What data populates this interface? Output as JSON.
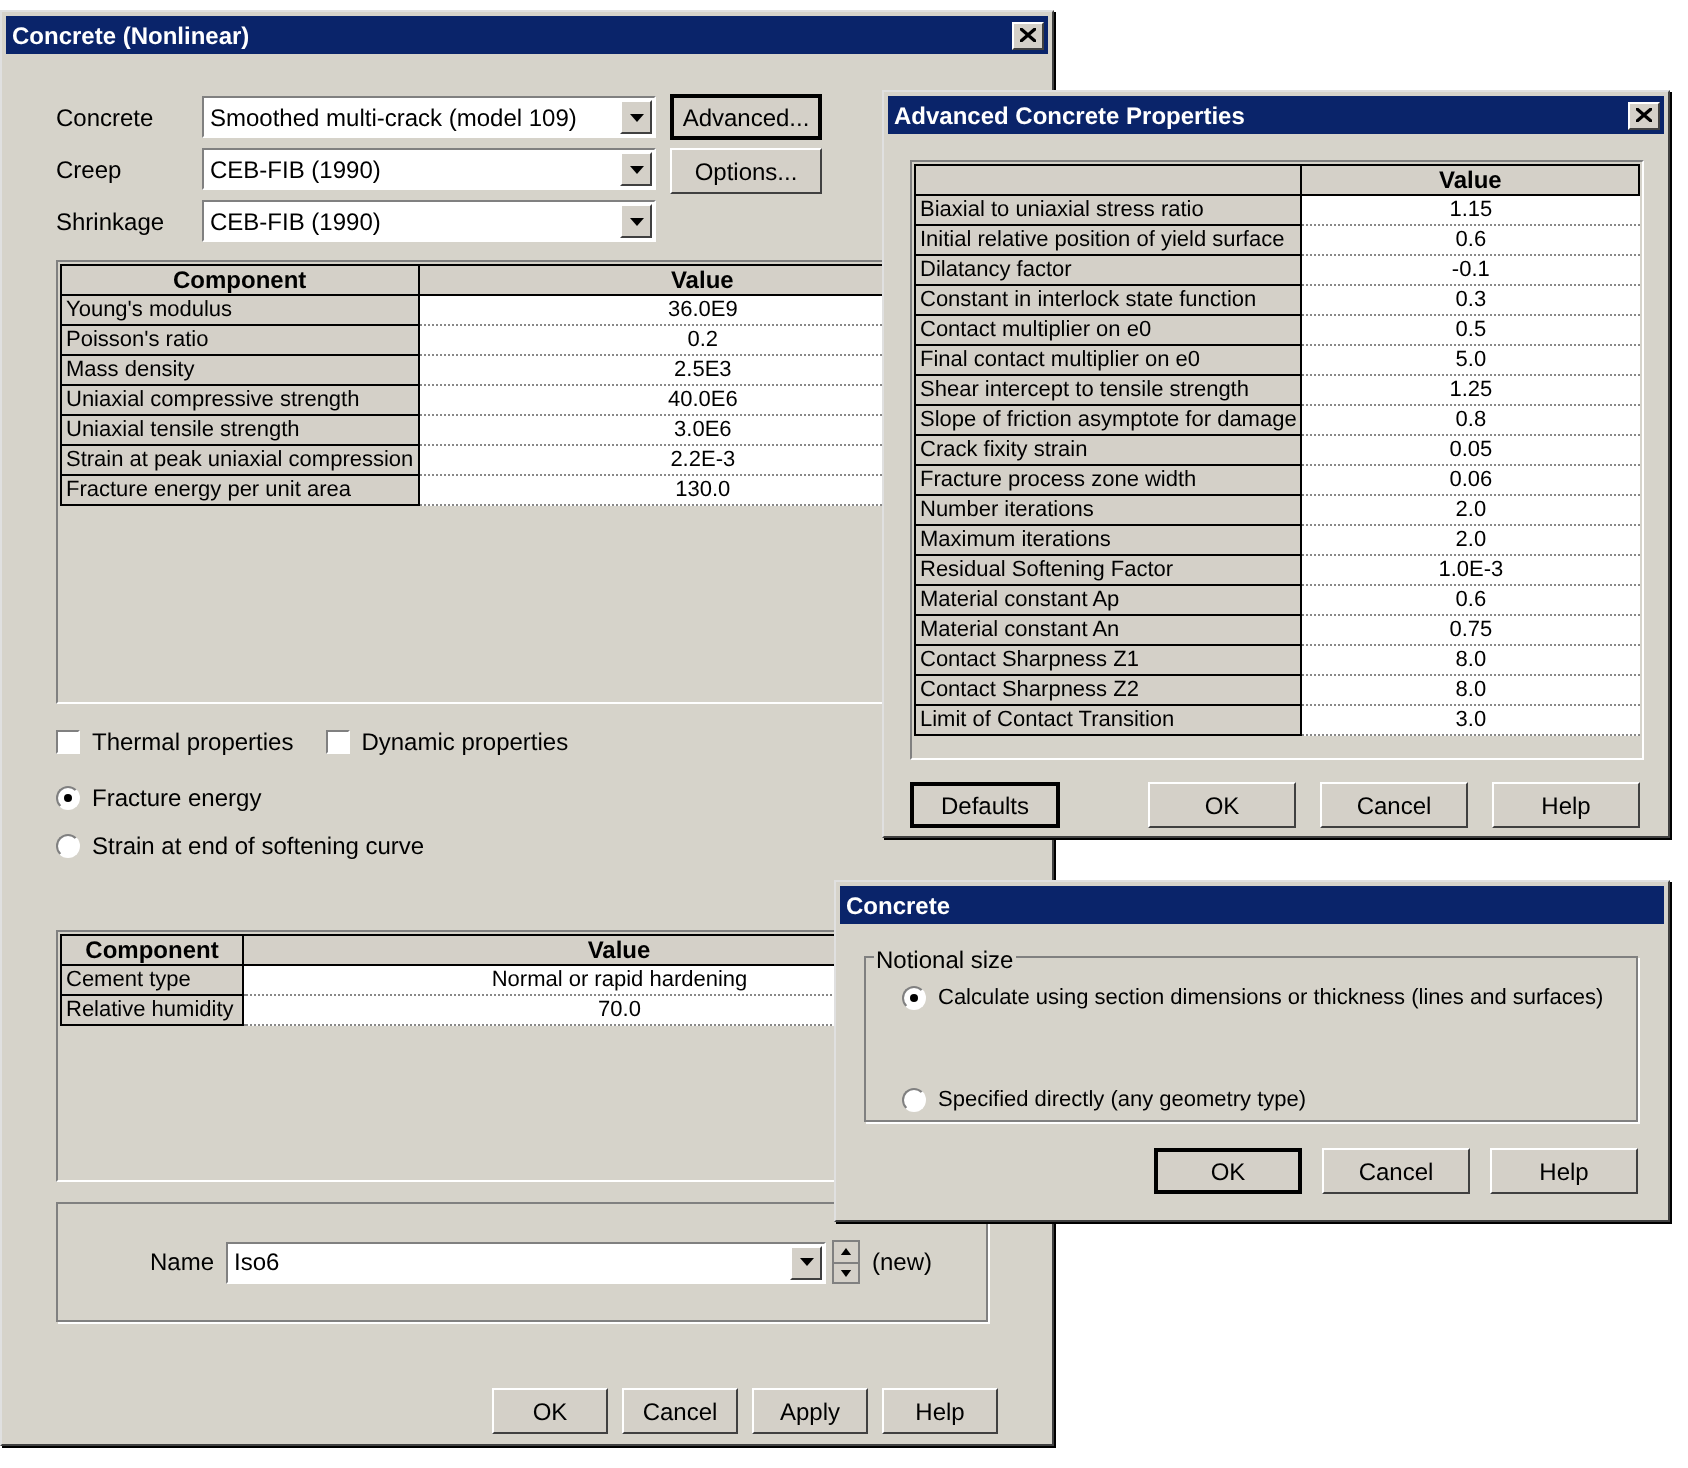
{
  "main_window": {
    "title": "Concrete (Nonlinear)",
    "fields": [
      {
        "label": "Concrete",
        "value": "Smoothed multi-crack (model 109)"
      },
      {
        "label": "Creep",
        "value": "CEB-FIB (1990)"
      },
      {
        "label": "Shrinkage",
        "value": "CEB-FIB (1990)"
      }
    ],
    "side_buttons": [
      {
        "label": "Advanced...",
        "default": true
      },
      {
        "label": "Options...",
        "default": false
      }
    ],
    "properties_table": {
      "columns": [
        "Component",
        "Value"
      ],
      "rows": [
        [
          "Young's modulus",
          "36.0E9"
        ],
        [
          "Poisson's ratio",
          "0.2"
        ],
        [
          "Mass density",
          "2.5E3"
        ],
        [
          "Uniaxial compressive strength",
          "40.0E6"
        ],
        [
          "Uniaxial tensile strength",
          "3.0E6"
        ],
        [
          "Strain at peak uniaxial compression",
          "2.2E-3"
        ],
        [
          "Fracture energy per unit area",
          "130.0"
        ]
      ]
    },
    "checkboxes": [
      {
        "label": "Thermal properties",
        "checked": false
      },
      {
        "label": "Dynamic properties",
        "checked": false
      }
    ],
    "radios": [
      {
        "label": "Fracture energy",
        "selected": true
      },
      {
        "label": "Strain at end of softening curve",
        "selected": false
      }
    ],
    "cement_table": {
      "columns": [
        "Component",
        "Value"
      ],
      "rows": [
        [
          "Cement type",
          "Normal or rapid hardening"
        ],
        [
          "Relative humidity",
          "70.0"
        ]
      ]
    },
    "name": {
      "label": "Name",
      "value": "Iso6",
      "status": "(new)"
    },
    "buttons": [
      {
        "label": "OK",
        "default": false
      },
      {
        "label": "Cancel",
        "default": false
      },
      {
        "label": "Apply",
        "default": false
      },
      {
        "label": "Help",
        "default": false
      }
    ]
  },
  "advanced_dialog": {
    "title": "Advanced Concrete Properties",
    "value_column": "Value",
    "rows": [
      [
        "Biaxial to uniaxial stress ratio",
        "1.15"
      ],
      [
        "Initial relative position of yield surface",
        "0.6"
      ],
      [
        "Dilatancy factor",
        "-0.1"
      ],
      [
        "Constant in interlock state function",
        "0.3"
      ],
      [
        "Contact multiplier on e0",
        "0.5"
      ],
      [
        "Final contact multiplier on e0",
        "5.0"
      ],
      [
        "Shear intercept to tensile strength",
        "1.25"
      ],
      [
        "Slope of friction asymptote for damage",
        "0.8"
      ],
      [
        "Crack fixity strain",
        "0.05"
      ],
      [
        "Fracture process zone width",
        "0.06"
      ],
      [
        "Number iterations",
        "2.0"
      ],
      [
        "Maximum iterations",
        "2.0"
      ],
      [
        "Residual Softening Factor",
        "1.0E-3"
      ],
      [
        "Material constant Ap",
        "0.6"
      ],
      [
        "Material constant An",
        "0.75"
      ],
      [
        "Contact Sharpness Z1",
        "8.0"
      ],
      [
        "Contact Sharpness Z2",
        "8.0"
      ],
      [
        "Limit of Contact Transition",
        "3.0"
      ]
    ],
    "left_button": {
      "label": "Defaults",
      "default": true
    },
    "buttons": [
      {
        "label": "OK",
        "default": false
      },
      {
        "label": "Cancel",
        "default": false
      },
      {
        "label": "Help",
        "default": false
      }
    ]
  },
  "concrete_dialog": {
    "title": "Concrete",
    "group_label": "Notional size",
    "radios": [
      {
        "label": "Calculate using section dimensions or thickness (lines and surfaces)",
        "selected": true
      },
      {
        "label": "Specified directly (any geometry type)",
        "selected": false
      }
    ],
    "buttons": [
      {
        "label": "OK",
        "default": true
      },
      {
        "label": "Cancel",
        "default": false
      },
      {
        "label": "Help",
        "default": false
      }
    ]
  }
}
